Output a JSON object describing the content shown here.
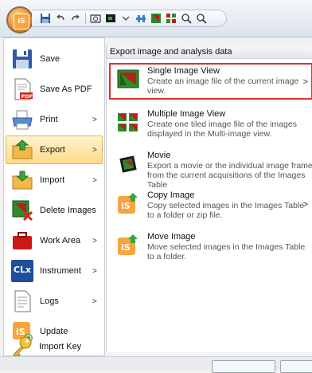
{
  "app": {
    "logo_text": "iS"
  },
  "quick_access": {
    "icons": [
      "save-icon",
      "undo-icon",
      "redo-icon",
      "snapshot-icon",
      "record-icon",
      "dropdown-icon",
      "link-icon",
      "image-icon",
      "grid-icon",
      "zoom-in-icon",
      "zoom-out-icon"
    ]
  },
  "menu": {
    "items": [
      {
        "label": "Save",
        "icon": "floppy-icon",
        "has_arrow": false
      },
      {
        "label": "Save As PDF",
        "icon": "pdf-icon",
        "has_arrow": false
      },
      {
        "label": "Print",
        "icon": "printer-icon",
        "has_arrow": true
      },
      {
        "label": "Export",
        "icon": "export-folder-icon",
        "has_arrow": true,
        "active": true
      },
      {
        "label": "Import",
        "icon": "import-folder-icon",
        "has_arrow": true
      },
      {
        "label": "Delete Images",
        "icon": "delete-image-icon",
        "has_arrow": false
      },
      {
        "label": "Work Area",
        "icon": "work-area-icon",
        "has_arrow": true
      },
      {
        "label": "Instrument",
        "icon": "instrument-icon",
        "has_arrow": true
      },
      {
        "label": "Logs",
        "icon": "log-icon",
        "has_arrow": true
      },
      {
        "label": "Update",
        "icon": "update-icon",
        "has_arrow": false
      },
      {
        "label": "Import Key",
        "icon": "key-icon",
        "has_arrow": false
      }
    ],
    "instrument_badge": "CLx"
  },
  "panel": {
    "header": "Export image and analysis data",
    "options": [
      {
        "title": "Single Image View",
        "description": "Create an image file of the current image view.",
        "has_arrow": true,
        "highlighted": true
      },
      {
        "title": "Multiple Image View",
        "description": "Create one tiled image file of the images displayed in the Multi-image view.",
        "has_arrow": false
      },
      {
        "title": "Movie",
        "description": "Export a movie or the individual image frames from the current acquisitions of the Images Table",
        "has_arrow": false
      },
      {
        "title": "Copy Image",
        "description": "Copy selected images in the Images Table to a folder or zip file.",
        "has_arrow": true
      },
      {
        "title": "Move Image",
        "description": "Move selected images in the Images Table to a folder.",
        "has_arrow": false
      }
    ]
  },
  "colors": {
    "highlight_border": "#d8342b",
    "active_item_bg": "#ffd98a"
  }
}
